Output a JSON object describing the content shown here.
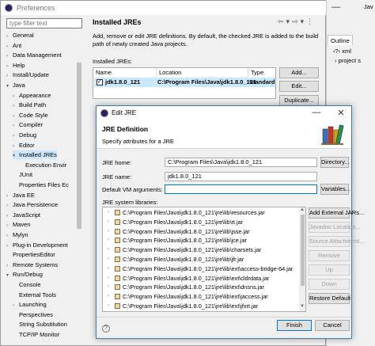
{
  "preferences": {
    "title": "Preferences",
    "filter_placeholder": "type filter text",
    "panel_title": "Installed JREs",
    "description": "Add, remove or edit JRE definitions. By default, the checked JRE is added to the build path of newly created Java projects.",
    "installed_label": "Installed JREs:",
    "table_headers": [
      "Name",
      "Location",
      "Type"
    ],
    "table_row": {
      "checked": true,
      "name": "jdk1.8.0_121",
      "location": "C:\\Program Files\\Java\\jdk1.8.0_121",
      "type": "Standard"
    },
    "buttons": {
      "add": "Add...",
      "edit": "Edit...",
      "duplicate": "Duplicate..."
    },
    "tree": [
      {
        "label": "General",
        "level": 0,
        "arrow": ">"
      },
      {
        "label": "Ant",
        "level": 0,
        "arrow": ">"
      },
      {
        "label": "Data Management",
        "level": 0,
        "arrow": ">"
      },
      {
        "label": "Help",
        "level": 0,
        "arrow": ">"
      },
      {
        "label": "Install/Update",
        "level": 0,
        "arrow": ">"
      },
      {
        "label": "Java",
        "level": 0,
        "arrow": "v"
      },
      {
        "label": "Appearance",
        "level": 1,
        "arrow": ">"
      },
      {
        "label": "Build Path",
        "level": 1,
        "arrow": ">"
      },
      {
        "label": "Code Style",
        "level": 1,
        "arrow": ">"
      },
      {
        "label": "Compiler",
        "level": 1,
        "arrow": ">"
      },
      {
        "label": "Debug",
        "level": 1,
        "arrow": ">"
      },
      {
        "label": "Editor",
        "level": 1,
        "arrow": ">"
      },
      {
        "label": "Installed JREs",
        "level": 1,
        "arrow": "v",
        "selected": true
      },
      {
        "label": "Execution Envir",
        "level": 2,
        "arrow": ""
      },
      {
        "label": "JUnit",
        "level": 1,
        "arrow": ""
      },
      {
        "label": "Properties Files Ec",
        "level": 1,
        "arrow": ""
      },
      {
        "label": "Java EE",
        "level": 0,
        "arrow": ">"
      },
      {
        "label": "Java Persistence",
        "level": 0,
        "arrow": ">"
      },
      {
        "label": "JavaScript",
        "level": 0,
        "arrow": ">"
      },
      {
        "label": "Maven",
        "level": 0,
        "arrow": ">"
      },
      {
        "label": "Mylyn",
        "level": 0,
        "arrow": ">"
      },
      {
        "label": "Plug-in Development",
        "level": 0,
        "arrow": ">"
      },
      {
        "label": "PropertiesEditor",
        "level": 0,
        "arrow": ""
      },
      {
        "label": "Remote Systems",
        "level": 0,
        "arrow": ">"
      },
      {
        "label": "Run/Debug",
        "level": 0,
        "arrow": "v"
      },
      {
        "label": "Console",
        "level": 1,
        "arrow": ""
      },
      {
        "label": "External Tools",
        "level": 1,
        "arrow": ""
      },
      {
        "label": "Launching",
        "level": 1,
        "arrow": ">"
      },
      {
        "label": "Perspectives",
        "level": 1,
        "arrow": ""
      },
      {
        "label": "String Substitution",
        "level": 1,
        "arrow": ""
      },
      {
        "label": "TCP/IP Monitor",
        "level": 1,
        "arrow": ""
      }
    ]
  },
  "workbench": {
    "tab_java": "Jav",
    "outline_tab": "Outline",
    "outline_item_1": "xml",
    "outline_item_2": "project s"
  },
  "dialog": {
    "title": "Edit JRE",
    "header_title": "JRE Definition",
    "header_desc": "Specify attributes for a JRE",
    "jre_home_label": "JRE home:",
    "jre_home_value": "C:\\Program Files\\Java\\jdk1.8.0_121",
    "directory_btn": "Directory...",
    "jre_name_label": "JRE name:",
    "jre_name_value": "jdk1.8.0_121",
    "vm_args_label": "Default VM arguments:",
    "vm_args_value": "",
    "variables_btn": "Variables...",
    "libs_label": "JRE system libraries:",
    "libraries": [
      "C:\\Program Files\\Java\\jdk1.8.0_121\\jre\\lib\\resources.jar",
      "C:\\Program Files\\Java\\jdk1.8.0_121\\jre\\lib\\rt.jar",
      "C:\\Program Files\\Java\\jdk1.8.0_121\\jre\\lib\\jsse.jar",
      "C:\\Program Files\\Java\\jdk1.8.0_121\\jre\\lib\\jce.jar",
      "C:\\Program Files\\Java\\jdk1.8.0_121\\jre\\lib\\charsets.jar",
      "C:\\Program Files\\Java\\jdk1.8.0_121\\jre\\lib\\jfr.jar",
      "C:\\Program Files\\Java\\jdk1.8.0_121\\jre\\lib\\ext\\access-bridge-64.jar",
      "C:\\Program Files\\Java\\jdk1.8.0_121\\jre\\lib\\ext\\cldrdata.jar",
      "C:\\Program Files\\Java\\jdk1.8.0_121\\jre\\lib\\ext\\dnsns.jar",
      "C:\\Program Files\\Java\\jdk1.8.0_121\\jre\\lib\\ext\\jaccess.jar",
      "C:\\Program Files\\Java\\jdk1.8.0_121\\jre\\lib\\ext\\jfxrt.jar"
    ],
    "lib_buttons": {
      "add_external": "Add External JARs...",
      "javadoc": "Javadoc Location...",
      "source": "Source Attachment...",
      "remove": "Remove",
      "up": "Up",
      "down": "Down",
      "restore": "Restore Default"
    },
    "finish": "Finish",
    "cancel": "Cancel",
    "help_icon": "?"
  }
}
